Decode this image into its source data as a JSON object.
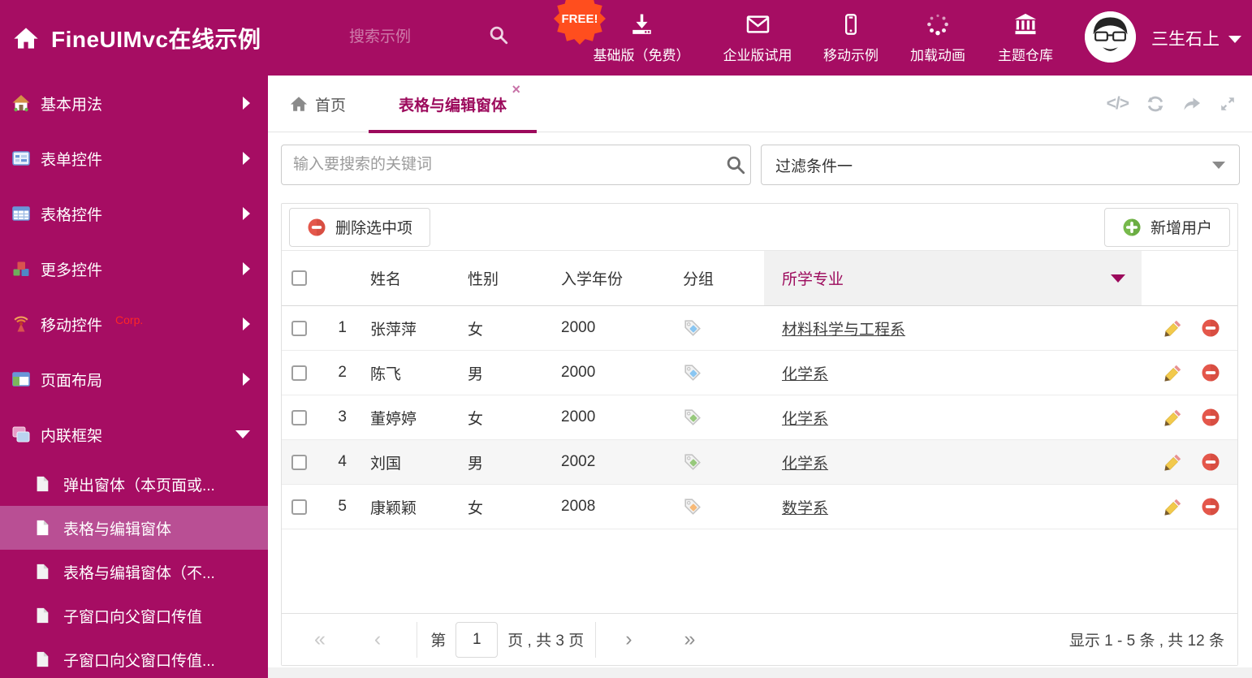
{
  "colors": {
    "accent": "#A60D63",
    "accent_dark": "#9C0A5C",
    "selected_subitem": "#B94F94",
    "free_badge": "#FF4E1E"
  },
  "header": {
    "title": "FineUIMvc在线示例",
    "search_placeholder": "搜索示例",
    "free_badge": "FREE!",
    "nav": [
      {
        "label": "基础版（免费）",
        "icon": "download-icon"
      },
      {
        "label": "企业版试用",
        "icon": "envelope-icon"
      },
      {
        "label": "移动示例",
        "icon": "mobile-icon"
      },
      {
        "label": "加载动画",
        "icon": "spinner-icon"
      },
      {
        "label": "主题仓库",
        "icon": "bank-icon"
      }
    ],
    "username": "三生石上"
  },
  "sidebar": {
    "items": [
      {
        "label": "基本用法",
        "icon": "home-icon"
      },
      {
        "label": "表单控件",
        "icon": "form-icon"
      },
      {
        "label": "表格控件",
        "icon": "table-icon"
      },
      {
        "label": "更多控件",
        "icon": "cubes-icon"
      },
      {
        "label": "移动控件",
        "badge": "Corp.",
        "icon": "antenna-icon"
      },
      {
        "label": "页面布局",
        "icon": "layout-icon"
      },
      {
        "label": "内联框架",
        "icon": "frames-icon",
        "expanded": true
      }
    ],
    "subitems": [
      {
        "label": "弹出窗体（本页面或..."
      },
      {
        "label": "表格与编辑窗体",
        "selected": true
      },
      {
        "label": "表格与编辑窗体（不..."
      },
      {
        "label": "子窗口向父窗口传值"
      },
      {
        "label": "子窗口向父窗口传值..."
      }
    ]
  },
  "tabs": {
    "home": "首页",
    "active": "表格与编辑窗体",
    "close": "×"
  },
  "search": {
    "placeholder": "输入要搜索的关键词"
  },
  "filter": {
    "value": "过滤条件一"
  },
  "toolbar": {
    "delete_label": "删除选中项",
    "add_label": "新增用户"
  },
  "table": {
    "columns": [
      "姓名",
      "性别",
      "入学年份",
      "分组",
      "所学专业"
    ],
    "rows": [
      {
        "num": "1",
        "name": "张萍萍",
        "gender": "女",
        "year": "2000",
        "tag_color": "#8AC6F2",
        "major": "材料科学与工程系"
      },
      {
        "num": "2",
        "name": "陈飞",
        "gender": "男",
        "year": "2000",
        "tag_color": "#8AC6F2",
        "major": "化学系"
      },
      {
        "num": "3",
        "name": "董婷婷",
        "gender": "女",
        "year": "2000",
        "tag_color": "#97C97C",
        "major": "化学系"
      },
      {
        "num": "4",
        "name": "刘国",
        "gender": "男",
        "year": "2002",
        "tag_color": "#97C97C",
        "major": "化学系"
      },
      {
        "num": "5",
        "name": "康颖颖",
        "gender": "女",
        "year": "2008",
        "tag_color": "#F7B977",
        "major": "数学系"
      }
    ]
  },
  "pagination": {
    "first": "«",
    "prev": "‹",
    "next": "›",
    "last": "»",
    "prefix": "第",
    "page": "1",
    "suffix": "页 , 共 3 页",
    "summary": "显示 1 - 5 条 , 共 12 条"
  }
}
